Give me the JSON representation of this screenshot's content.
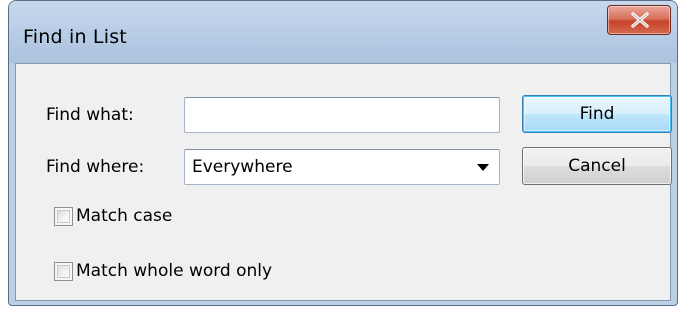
{
  "window": {
    "title": "Find in List"
  },
  "form": {
    "find_what_label": "Find what:",
    "find_what_value": "",
    "find_where_label": "Find where:",
    "find_where_selected": "Everywhere"
  },
  "options": {
    "match_case_label": "Match case",
    "match_case_checked": false,
    "match_whole_word_label": "Match whole word only",
    "match_whole_word_checked": false
  },
  "buttons": {
    "find_label": "Find",
    "cancel_label": "Cancel"
  },
  "icons": {
    "close": "close-icon",
    "dropdown": "chevron-down-icon"
  },
  "colors": {
    "default_button_border": "#3c7fb1",
    "close_button": "#c7432a"
  }
}
